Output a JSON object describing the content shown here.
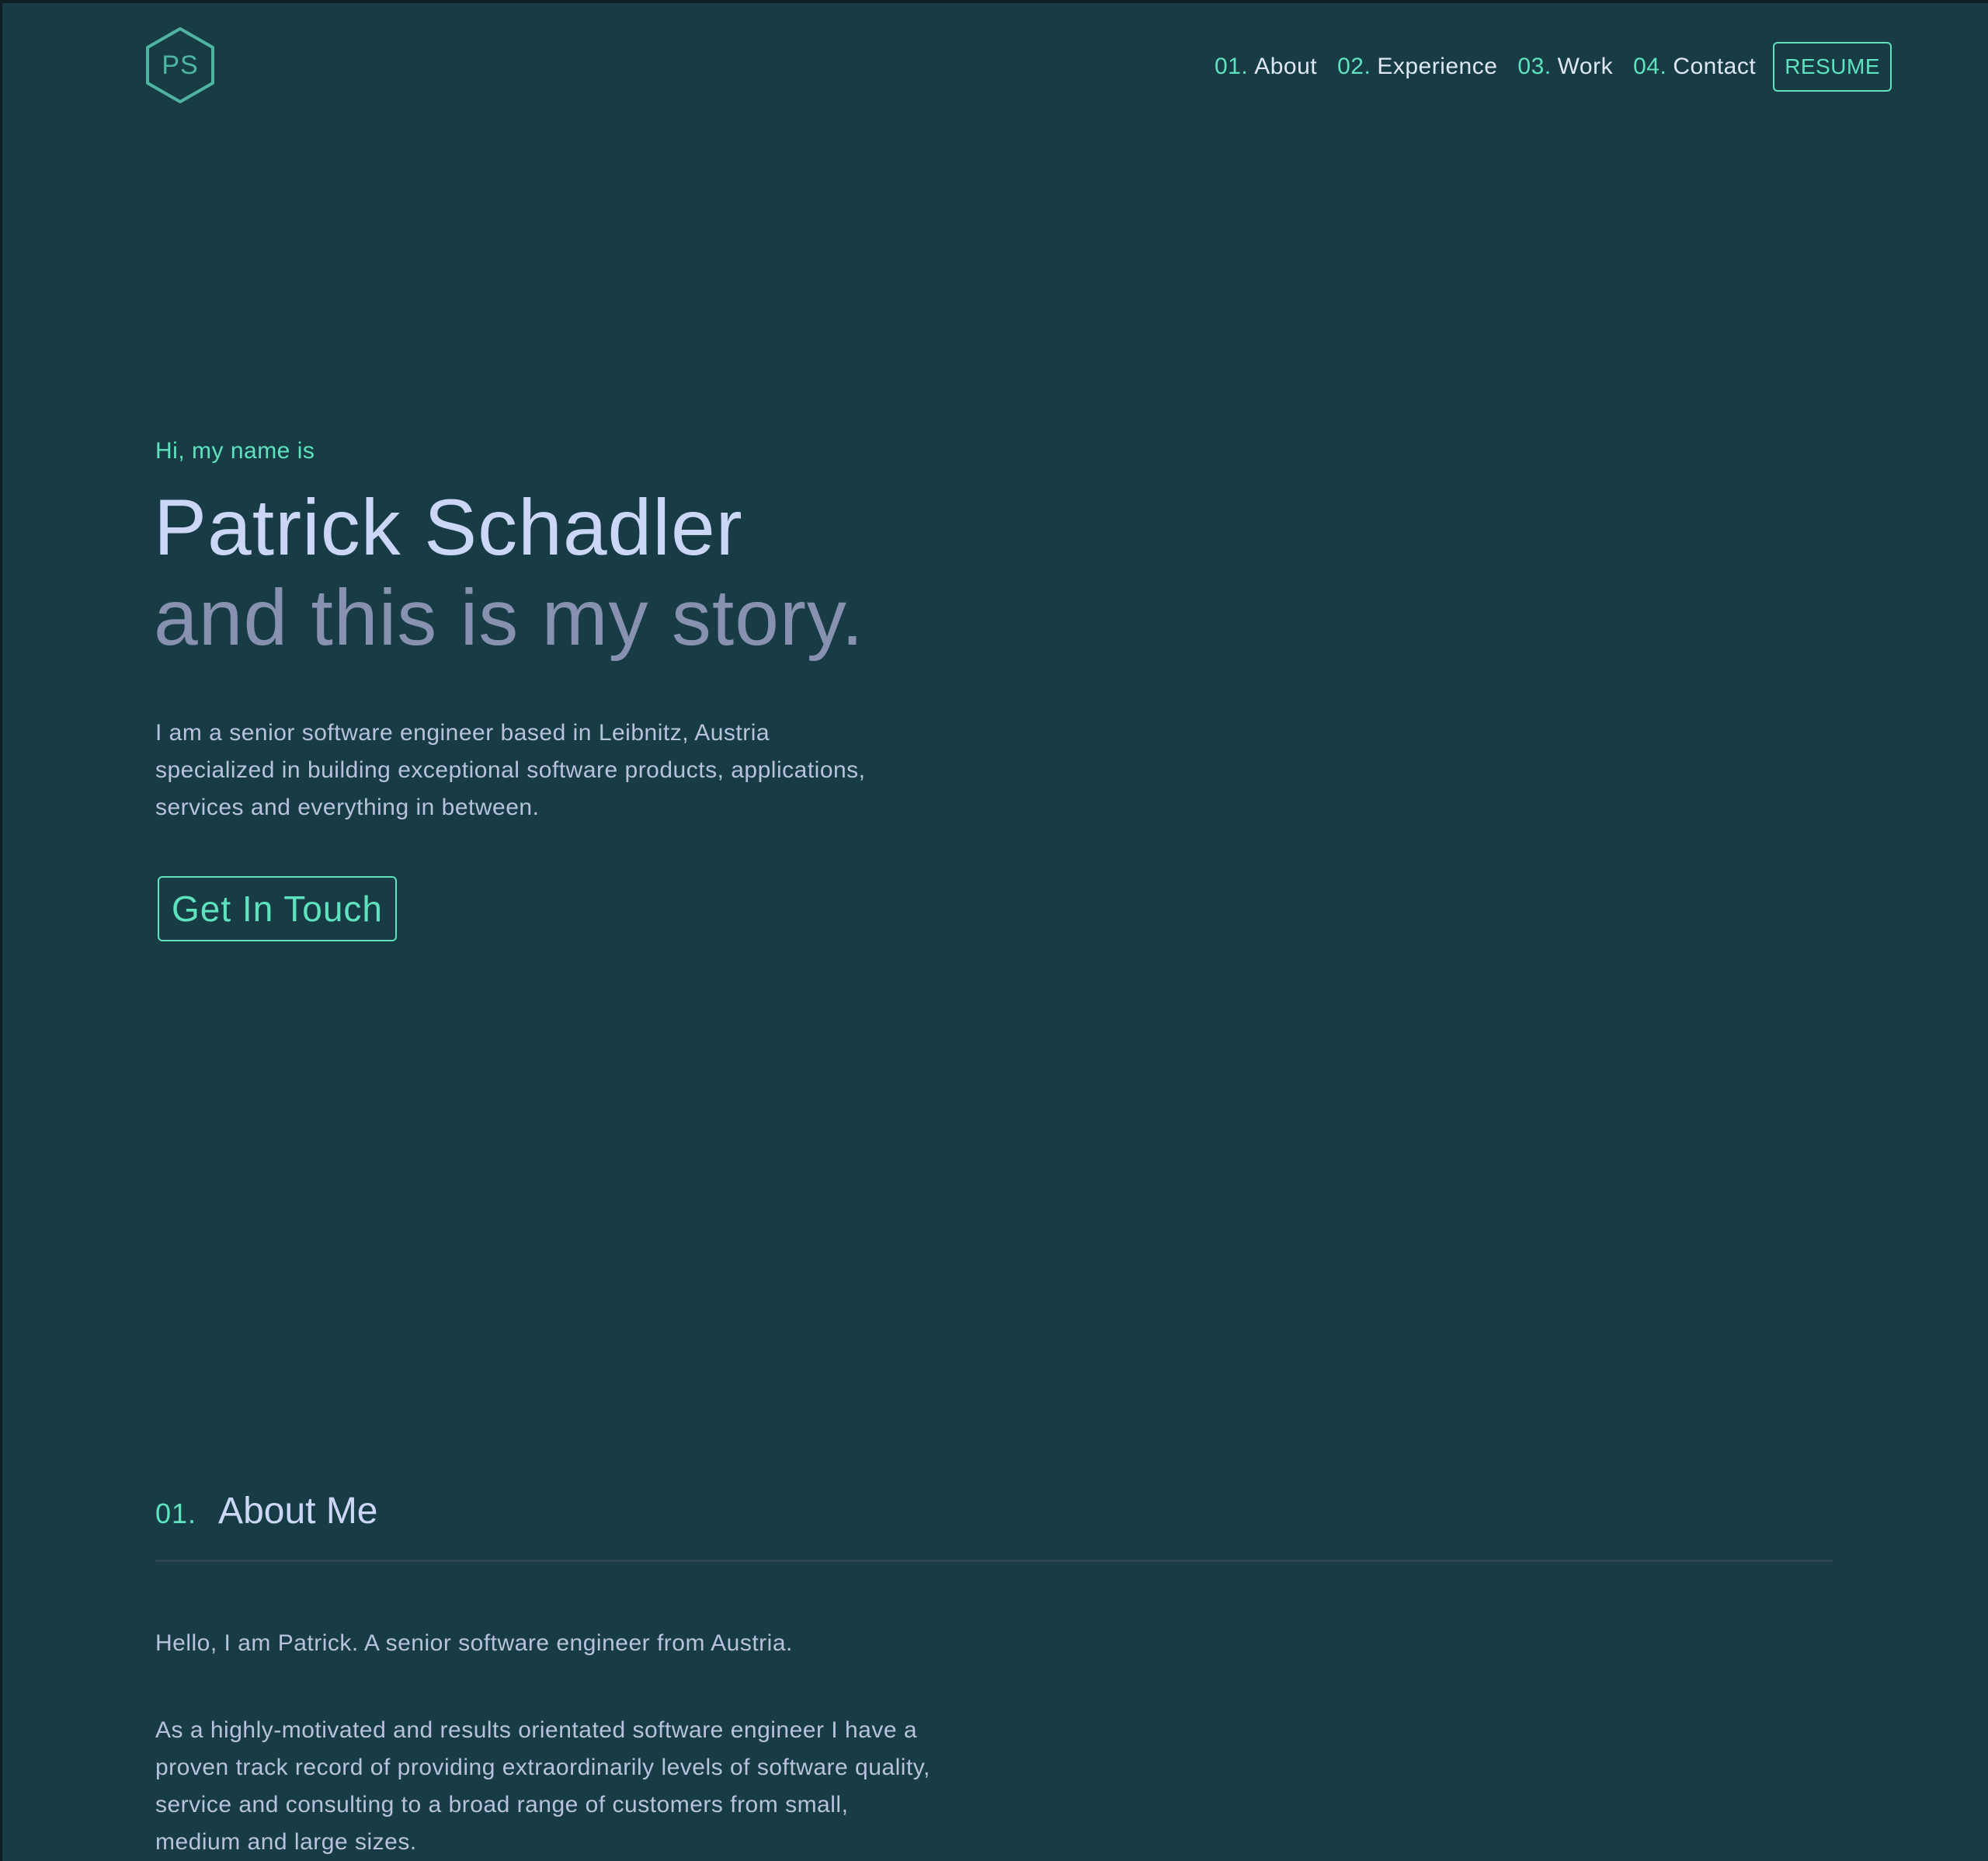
{
  "header": {
    "logo_text": "PS",
    "nav": [
      {
        "num": "01.",
        "label": "About"
      },
      {
        "num": "02.",
        "label": "Experience"
      },
      {
        "num": "03.",
        "label": "Work"
      },
      {
        "num": "04.",
        "label": "Contact"
      }
    ],
    "resume_label": "RESUME"
  },
  "hero": {
    "intro": "Hi, my name is",
    "name": "Patrick Schadler",
    "tagline": "and this is my story.",
    "description": "I am a senior software engineer based in Leibnitz, Austria specialized in building exceptional software products, applications, services and everything in between.",
    "cta_label": "Get In Touch"
  },
  "about": {
    "num": "01.",
    "title": "About Me",
    "p1": "Hello, I am Patrick. A senior software engineer from Austria.",
    "p2": "As a highly-motivated and results orientated software engineer I have a proven track record of providing extraordinarily levels of software quality, service and consulting to a broad range of customers from small, medium and large sizes."
  },
  "colors": {
    "background": "#183c46",
    "accent": "#5fe3be",
    "heading": "#ccd6f6",
    "muted": "#8892b0",
    "body_text": "#b8c2dc"
  },
  "icons": {
    "logo": "hexagon-logo-icon"
  }
}
